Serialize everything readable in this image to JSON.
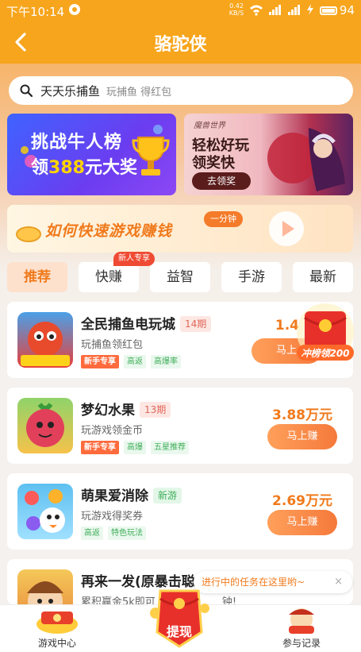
{
  "status_bar": {
    "time": "下午10:14",
    "net_speed": "0.42 KB/S",
    "battery": "94"
  },
  "header": {
    "title": "骆驼侠",
    "back_icon": "chevron-left-icon"
  },
  "search": {
    "query": "天天乐捕鱼",
    "placeholder": "玩捕鱼 得红包"
  },
  "banners": [
    {
      "line1": "挑战牛人榜",
      "line2_prefix": "领",
      "line2_highlight": "388",
      "line2_suffix": "元大奖"
    },
    {
      "brand": "魔兽世界",
      "line1": "轻松好玩",
      "line2": "领奖快",
      "button": "去领奖"
    }
  ],
  "howto": {
    "text": "如何快速游戏赚钱",
    "badge": "一分钟"
  },
  "tabs": {
    "items": [
      {
        "label": "推荐",
        "active": true
      },
      {
        "label": "快赚",
        "active": false
      },
      {
        "label": "益智",
        "active": false
      },
      {
        "label": "手游",
        "active": false
      },
      {
        "label": "最新",
        "active": false
      }
    ],
    "new_user_badge": "新人专享"
  },
  "promo": {
    "text": "冲榜领200"
  },
  "games": [
    {
      "name": "全民捕鱼电玩城",
      "tag": "14期",
      "tag_type": "period",
      "desc": "玩捕鱼领红包",
      "labels": [
        "新手专享",
        "高返",
        "高爆率"
      ],
      "reward": "1.4",
      "button": "马上"
    },
    {
      "name": "梦幻水果",
      "tag": "13期",
      "tag_type": "period",
      "desc": "玩游戏领金币",
      "labels": [
        "新手专享",
        "高爆",
        "五星推荐"
      ],
      "reward": "3.88万元",
      "button": "马上赚"
    },
    {
      "name": "萌果爱消除",
      "tag": "新游",
      "tag_type": "newgame",
      "desc": "玩游戏得奖券",
      "labels": [
        "高返",
        "特色玩法"
      ],
      "reward": "2.69万元",
      "button": "马上赚"
    },
    {
      "name": "再来一发(原暴击聪",
      "desc": "累积赢金5k即可",
      "extra": "钟!"
    }
  ],
  "toast": {
    "text": "进行中的任务在这里哟~",
    "close": "×"
  },
  "bottom_nav": {
    "left_label": "游戏中心",
    "center_label": "提现",
    "right_label": "参与记录"
  },
  "colors": {
    "accent": "#f7a51c",
    "reward": "#f07a1c",
    "button": "#f5793b"
  }
}
